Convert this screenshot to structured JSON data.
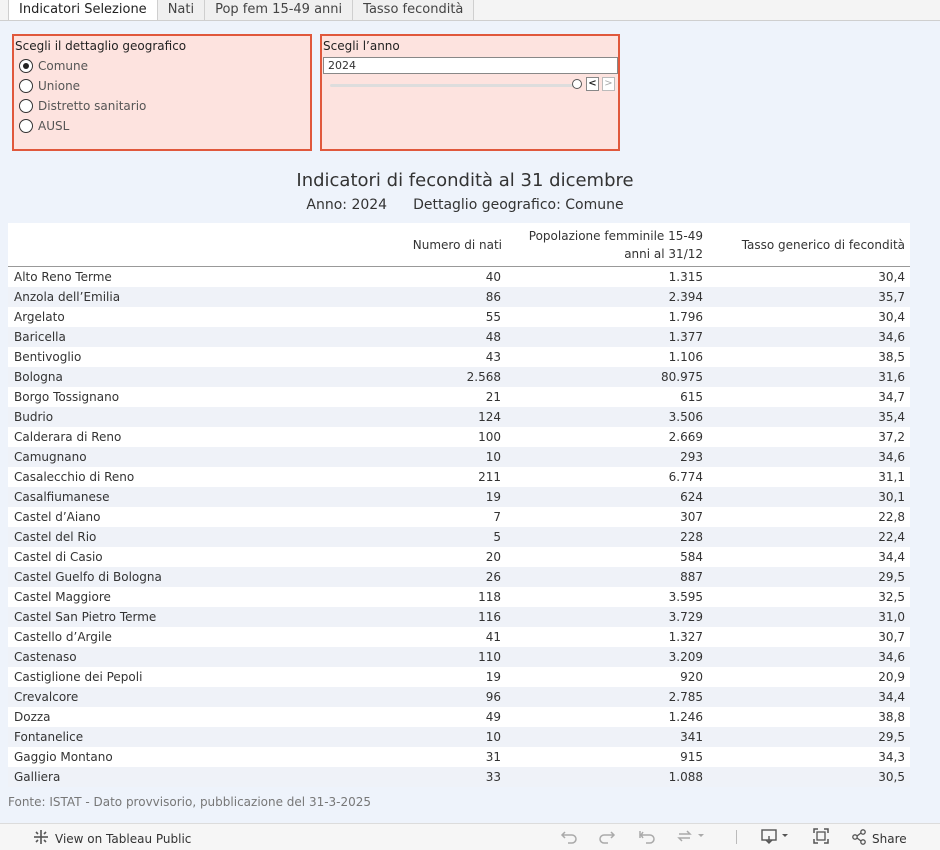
{
  "tabs": [
    "Indicatori Selezione",
    "Nati",
    "Pop fem 15-49 anni",
    "Tasso fecondità"
  ],
  "filters": {
    "geo": {
      "title": "Scegli il dettaglio geografico",
      "options": [
        "Comune",
        "Unione",
        "Distretto sanitario",
        "AUSL"
      ],
      "selected": "Comune"
    },
    "year": {
      "title": "Scegli l’anno",
      "value": "2024",
      "prev": "<",
      "next": ">"
    }
  },
  "header": {
    "title": "Indicatori di fecondità al 31 dicembre",
    "anno": "Anno: 2024",
    "dettaglio": "Dettaglio geografico: Comune"
  },
  "table": {
    "columns": [
      "Numero di nati",
      "Popolazione femminile 15-49 anni al 31/12",
      "Tasso generico di fecondità"
    ],
    "rows": [
      [
        "Alto Reno Terme",
        "40",
        "1.315",
        "30,4"
      ],
      [
        "Anzola dell’Emilia",
        "86",
        "2.394",
        "35,7"
      ],
      [
        "Argelato",
        "55",
        "1.796",
        "30,4"
      ],
      [
        "Baricella",
        "48",
        "1.377",
        "34,6"
      ],
      [
        "Bentivoglio",
        "43",
        "1.106",
        "38,5"
      ],
      [
        "Bologna",
        "2.568",
        "80.975",
        "31,6"
      ],
      [
        "Borgo Tossignano",
        "21",
        "615",
        "34,7"
      ],
      [
        "Budrio",
        "124",
        "3.506",
        "35,4"
      ],
      [
        "Calderara di Reno",
        "100",
        "2.669",
        "37,2"
      ],
      [
        "Camugnano",
        "10",
        "293",
        "34,6"
      ],
      [
        "Casalecchio di Reno",
        "211",
        "6.774",
        "31,1"
      ],
      [
        "Casalfiumanese",
        "19",
        "624",
        "30,1"
      ],
      [
        "Castel d’Aiano",
        "7",
        "307",
        "22,8"
      ],
      [
        "Castel del Rio",
        "5",
        "228",
        "22,4"
      ],
      [
        "Castel di Casio",
        "20",
        "584",
        "34,4"
      ],
      [
        "Castel Guelfo di Bologna",
        "26",
        "887",
        "29,5"
      ],
      [
        "Castel Maggiore",
        "118",
        "3.595",
        "32,5"
      ],
      [
        "Castel San Pietro Terme",
        "116",
        "3.729",
        "31,0"
      ],
      [
        "Castello d’Argile",
        "41",
        "1.327",
        "30,7"
      ],
      [
        "Castenaso",
        "110",
        "3.209",
        "34,6"
      ],
      [
        "Castiglione dei Pepoli",
        "19",
        "920",
        "20,9"
      ],
      [
        "Crevalcore",
        "96",
        "2.785",
        "34,4"
      ],
      [
        "Dozza",
        "49",
        "1.246",
        "38,8"
      ],
      [
        "Fontanelice",
        "10",
        "341",
        "29,5"
      ],
      [
        "Gaggio Montano",
        "31",
        "915",
        "34,3"
      ],
      [
        "Galliera",
        "33",
        "1.088",
        "30,5"
      ]
    ]
  },
  "source": "Fonte: ISTAT - Dato provvisorio, pubblicazione del 31-3-2025",
  "toolbar": {
    "view_label": "View on Tableau Public",
    "share_label": "Share"
  },
  "icons": {
    "tableau_logo": "tableau-logo-icon",
    "undo": "undo-icon",
    "redo": "redo-icon",
    "revert": "revert-icon",
    "refresh": "refresh-icon",
    "download": "download-icon",
    "fullscreen": "fullscreen-icon",
    "share": "share-icon"
  }
}
